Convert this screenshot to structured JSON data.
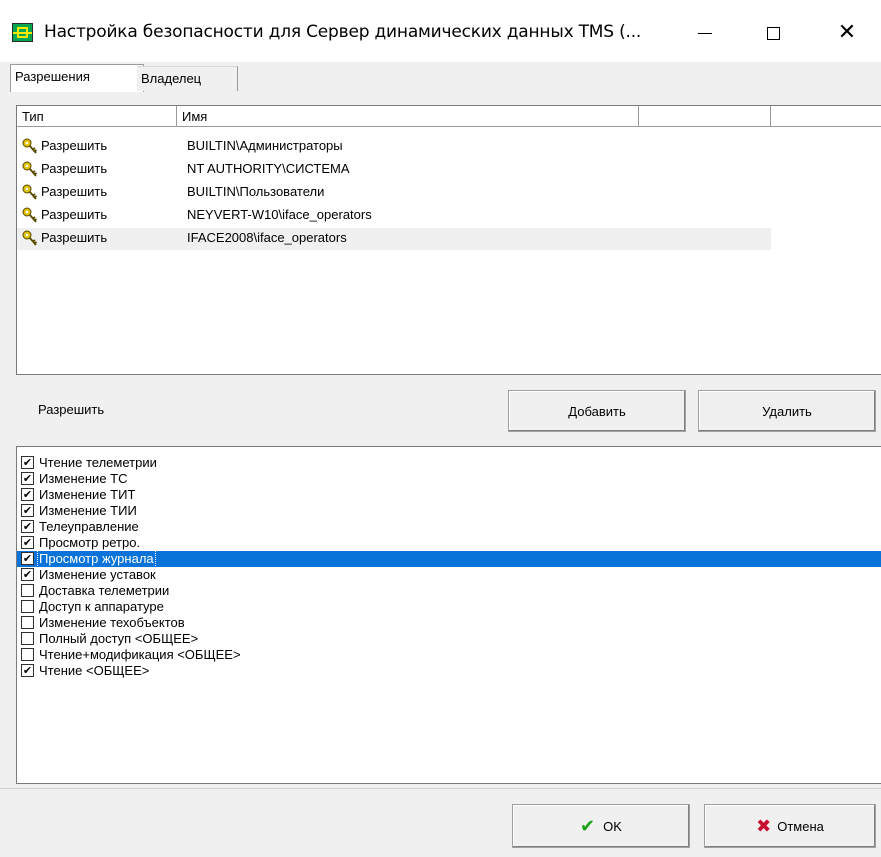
{
  "window": {
    "title": "Настройка безопасности для Сервер динамических данных TMS (...",
    "app_icon": "tms-app-icon",
    "controls": {
      "minimize": "—",
      "maximize": "☐",
      "close": "✕"
    }
  },
  "tabs": [
    {
      "label": "Разрешения",
      "active": true
    },
    {
      "label": "Владелец",
      "active": false
    }
  ],
  "acl": {
    "columns": [
      "Тип",
      "Имя",
      "",
      ""
    ],
    "rows": [
      {
        "type": "Разрешить",
        "name": "BUILTIN\\Администраторы",
        "icon": "key-icon"
      },
      {
        "type": "Разрешить",
        "name": "NT AUTHORITY\\СИСТЕМА",
        "icon": "key-icon"
      },
      {
        "type": "Разрешить",
        "name": "BUILTIN\\Пользователи",
        "icon": "key-icon"
      },
      {
        "type": "Разрешить",
        "name": "NEYVERT-W10\\iface_operators",
        "icon": "key-icon"
      },
      {
        "type": "Разрешить",
        "name": "IFACE2008\\iface_operators",
        "icon": "key-icon"
      }
    ],
    "selected_row": 4
  },
  "middle": {
    "permission_label": "Разрешить",
    "add_button": "Добавить",
    "delete_button": "Удалить"
  },
  "permissions": {
    "items": [
      {
        "label": "Чтение телеметрии",
        "checked": true
      },
      {
        "label": "Изменение ТС",
        "checked": true
      },
      {
        "label": "Изменение ТИТ",
        "checked": true
      },
      {
        "label": "Изменение ТИИ",
        "checked": true
      },
      {
        "label": "Телеуправление",
        "checked": true
      },
      {
        "label": "Просмотр ретро.",
        "checked": true
      },
      {
        "label": "Просмотр журнала",
        "checked": true
      },
      {
        "label": "Изменение уставок",
        "checked": true
      },
      {
        "label": "Доставка телеметрии",
        "checked": false
      },
      {
        "label": "Доступ к аппаратуре",
        "checked": false
      },
      {
        "label": "Изменение техобъектов",
        "checked": false
      },
      {
        "label": "Полный доступ <ОБЩЕЕ>",
        "checked": false
      },
      {
        "label": "Чтение+модификация <ОБЩЕЕ>",
        "checked": false
      },
      {
        "label": "Чтение <ОБЩЕЕ>",
        "checked": true
      }
    ],
    "selected_index": 6
  },
  "footer": {
    "ok_button": "OK",
    "ok_icon": "green-checkmark-icon",
    "cancel_button": "Отмена",
    "cancel_icon": "red-x-icon"
  },
  "colors": {
    "selection": "#0a73d9",
    "window_bg": "#f0f0f0",
    "ok_check": "#1aa31a",
    "cancel_x": "#c8102e"
  }
}
